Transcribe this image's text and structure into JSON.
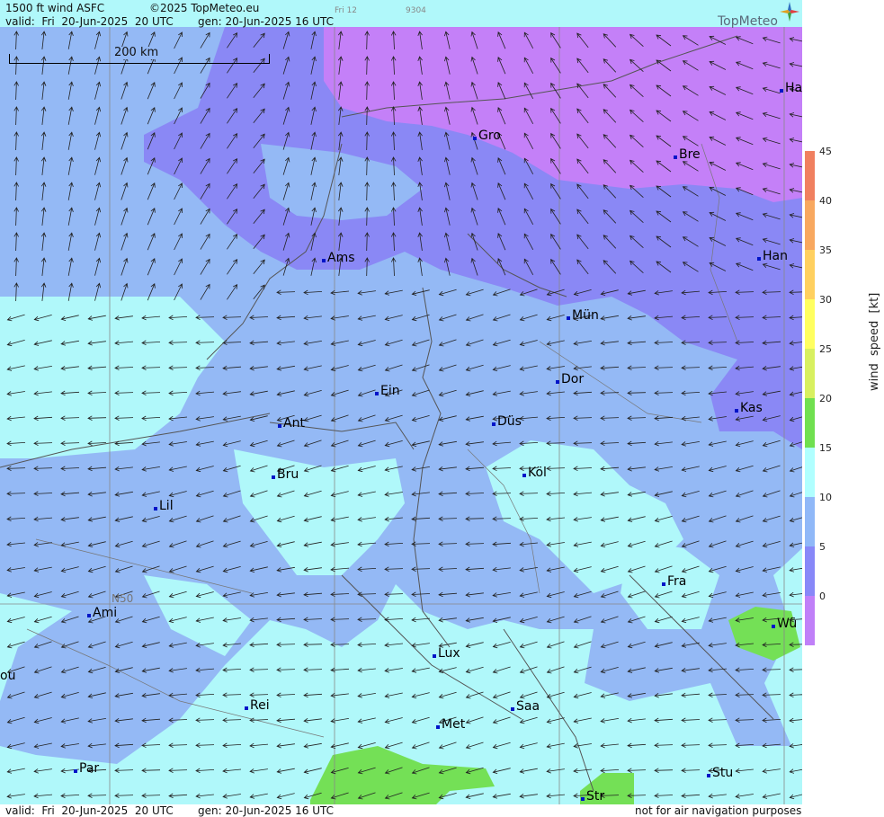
{
  "header": {
    "product": "1500 ft wind ASFC",
    "copyright": "©2025 TopMeteo.eu",
    "day_code": "Fri 12",
    "code": "9304",
    "valid": "valid:  Fri  20-Jun-2025  20 UTC",
    "generated": "gen: 20-Jun-2025 16 UTC"
  },
  "footer": {
    "valid": "valid:  Fri  20-Jun-2025  20 UTC",
    "generated": "gen: 20-Jun-2025 16 UTC",
    "disclaimer": "not for air navigation purposes"
  },
  "logo": {
    "text": "TopMeteo",
    "icon": "compass-star-icon"
  },
  "scale_bar": {
    "label": "200 km"
  },
  "graticule": {
    "label": "N50"
  },
  "cities": [
    {
      "name": "Ha"
    },
    {
      "name": "Gro"
    },
    {
      "name": "Bre"
    },
    {
      "name": "Ams"
    },
    {
      "name": "Han"
    },
    {
      "name": "Mün"
    },
    {
      "name": "Ein"
    },
    {
      "name": "Dor"
    },
    {
      "name": "Ant"
    },
    {
      "name": "Düs"
    },
    {
      "name": "Kas"
    },
    {
      "name": "Bru"
    },
    {
      "name": "Köl"
    },
    {
      "name": "Lil"
    },
    {
      "name": "Fra"
    },
    {
      "name": "Ami"
    },
    {
      "name": "Wü"
    },
    {
      "name": "Lux"
    },
    {
      "name": "ou"
    },
    {
      "name": "Rei"
    },
    {
      "name": "Saa"
    },
    {
      "name": "Met"
    },
    {
      "name": "Stu"
    },
    {
      "name": "Par"
    },
    {
      "name": "Str"
    }
  ],
  "legend": {
    "title": "wind  speed  [kt]",
    "ticks": [
      "45",
      "40",
      "35",
      "30",
      "25",
      "20",
      "15",
      "10",
      "5",
      "0"
    ],
    "colors": [
      "#f08060",
      "#f8a860",
      "#ffd060",
      "#ffff60",
      "#d8f060",
      "#70e050",
      "#b0ffff",
      "#90b8f8",
      "#8888f8",
      "#c080f8"
    ]
  },
  "wind": {
    "prevailing": "from east",
    "arrow_icon": "wind-arrow-icon"
  }
}
